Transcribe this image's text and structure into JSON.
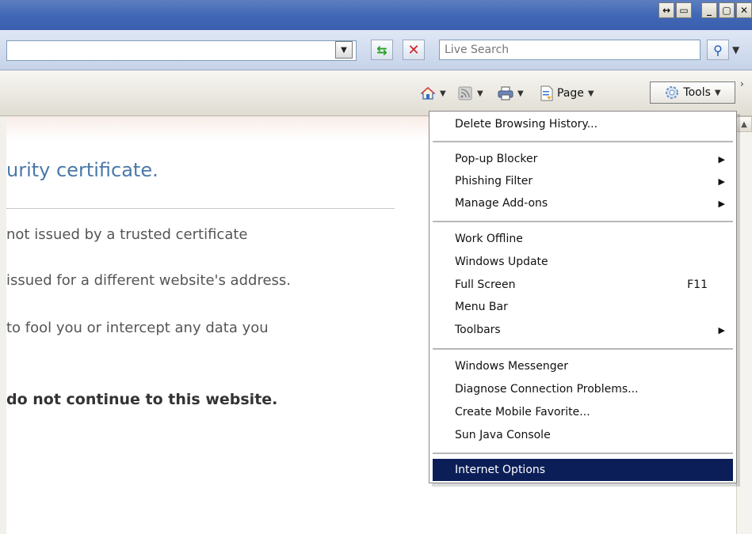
{
  "window": {
    "buttons": [
      "↔",
      "▭",
      "_",
      "▢",
      "✕"
    ]
  },
  "address_bar": {
    "search_placeholder": "Live Search"
  },
  "command_bar": {
    "page_label": "Page",
    "tools_label": "Tools"
  },
  "page": {
    "heading": "urity certificate.",
    "line1": "not issued by a trusted certificate",
    "line2": "issued for a different website's address.",
    "line3": "to fool you or intercept any data you",
    "line4": "do not continue to this website."
  },
  "tools_menu": {
    "items": [
      {
        "label": "Delete Browsing History..."
      },
      {
        "label": "Pop-up Blocker"
      },
      {
        "label": "Phishing Filter"
      },
      {
        "label": "Manage Add-ons"
      },
      {
        "label": "Work Offline"
      },
      {
        "label": "Windows Update"
      },
      {
        "label": "Full Screen",
        "shortcut": "F11"
      },
      {
        "label": "Menu Bar"
      },
      {
        "label": "Toolbars"
      },
      {
        "label": "Windows Messenger"
      },
      {
        "label": "Diagnose Connection Problems..."
      },
      {
        "label": "Create Mobile Favorite..."
      },
      {
        "label": "Sun Java Console"
      },
      {
        "label": "Internet Options"
      }
    ]
  }
}
